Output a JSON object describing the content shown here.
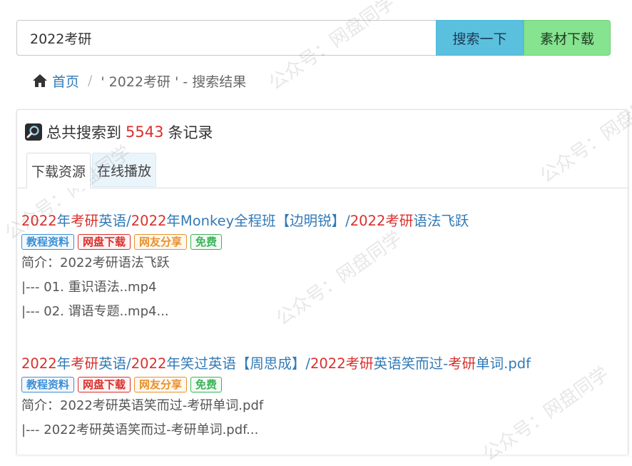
{
  "search": {
    "query": "2022考研",
    "search_button": "搜索一下",
    "download_button": "素材下载"
  },
  "breadcrumb": {
    "home": "首页",
    "separator": "/",
    "current": "' 2022考研 ' - 搜索结果"
  },
  "summary": {
    "prefix": "总共搜索到",
    "count": "5543",
    "suffix": "条记录"
  },
  "tabs": [
    "下载资源",
    "在线播放"
  ],
  "results": [
    {
      "title_parts": [
        {
          "t": "2022",
          "hl": true
        },
        {
          "t": "年",
          "hl": false
        },
        {
          "t": "考研",
          "hl": true
        },
        {
          "t": "英语/",
          "hl": false
        },
        {
          "t": "2022",
          "hl": true
        },
        {
          "t": "年Monkey全程班【边明锐】/",
          "hl": false
        },
        {
          "t": "2022考研",
          "hl": true
        },
        {
          "t": "语法飞跃",
          "hl": false
        }
      ],
      "tags": [
        "教程资料",
        "网盘下载",
        "网友分享",
        "免费"
      ],
      "summary": "简介：2022考研语法飞跃",
      "files": [
        "|--- 01. 重识语法..mp4",
        "|--- 02. 谓语专题..mp4..."
      ]
    },
    {
      "title_parts": [
        {
          "t": "2022",
          "hl": true
        },
        {
          "t": "年",
          "hl": false
        },
        {
          "t": "考研",
          "hl": true
        },
        {
          "t": "英语/",
          "hl": false
        },
        {
          "t": "2022",
          "hl": true
        },
        {
          "t": "年笑过英语【周思成】/",
          "hl": false
        },
        {
          "t": "2022考研",
          "hl": true
        },
        {
          "t": "英语笑而过-",
          "hl": false
        },
        {
          "t": "考研",
          "hl": true
        },
        {
          "t": "单词.pdf",
          "hl": false
        }
      ],
      "tags": [
        "教程资料",
        "网盘下载",
        "网友分享",
        "免费"
      ],
      "summary": "简介：2022考研英语笑而过-考研单词.pdf",
      "files": [
        "|--- 2022考研英语笑而过-考研单词.pdf..."
      ]
    }
  ],
  "watermark": "公众号：网盘同学",
  "colors": {
    "link": "#337ab7",
    "highlight": "#d9302c",
    "search_button": "#5bc0de",
    "download_button": "#86e38f"
  }
}
